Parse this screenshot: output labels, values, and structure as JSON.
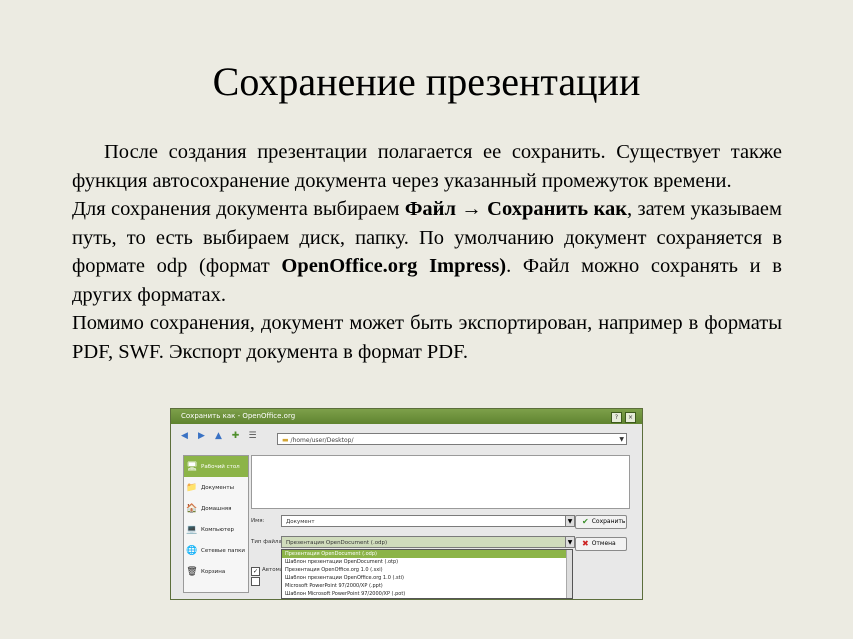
{
  "slide": {
    "title": "Сохранение презентации",
    "para1": "После создания презентации полагается ее сохранить. Существует также функция автосохранение документа через указанный промежуток времени.",
    "para2_a": "Для сохранения документа выбираем ",
    "para2_b": "Файл → Сохранить как",
    "para2_c": ", затем указываем путь, то есть выбираем диск, папку. По умолчанию документ сохраняется в формате odp (формат ",
    "para2_d": "OpenOffice.org Impress)",
    "para2_e": ". Файл можно сохранять и в других форматах.",
    "para3": "Помимо сохранения, документ может быть экспортирован, например в форматы PDF, SWF. Экспорт документа в формат PDF."
  },
  "dialog": {
    "title": "Сохранить как - OpenOffice.org",
    "window_buttons": [
      "?",
      "×"
    ],
    "location": "/home/user/Desktop/",
    "places": [
      {
        "icon": "desktop-icon",
        "glyph": "🖥",
        "label": "Рабочий стол"
      },
      {
        "icon": "documents-icon",
        "glyph": "📁",
        "label": "Документы"
      },
      {
        "icon": "home-icon",
        "glyph": "🏠",
        "label": "Домашняя"
      },
      {
        "icon": "computer-icon",
        "glyph": "💻",
        "label": "Компьютер"
      },
      {
        "icon": "network-icon",
        "glyph": "🌐",
        "label": "Сетевые папки"
      },
      {
        "icon": "trash-icon",
        "glyph": "🗑",
        "label": "Корзина"
      }
    ],
    "name_label": "Имя:",
    "name_value": "Документ",
    "type_label": "Тип файла:",
    "type_value": "Презентация OpenDocument (.odp)",
    "save_button": "Сохранить",
    "cancel_button": "Отмена",
    "auto_ext_label": "Автоматическое расширение",
    "type_options": [
      "Презентация OpenDocument (.odp)",
      "Шаблон презентации OpenDocument (.otp)",
      "Презентация OpenOffice.org 1.0 (.sxi)",
      "Шаблон презентации OpenOffice.org 1.0 (.sti)",
      "Microsoft PowerPoint 97/2000/XP (.ppt)",
      "Шаблон Microsoft PowerPoint 97/2000/XP (.pot)"
    ]
  }
}
